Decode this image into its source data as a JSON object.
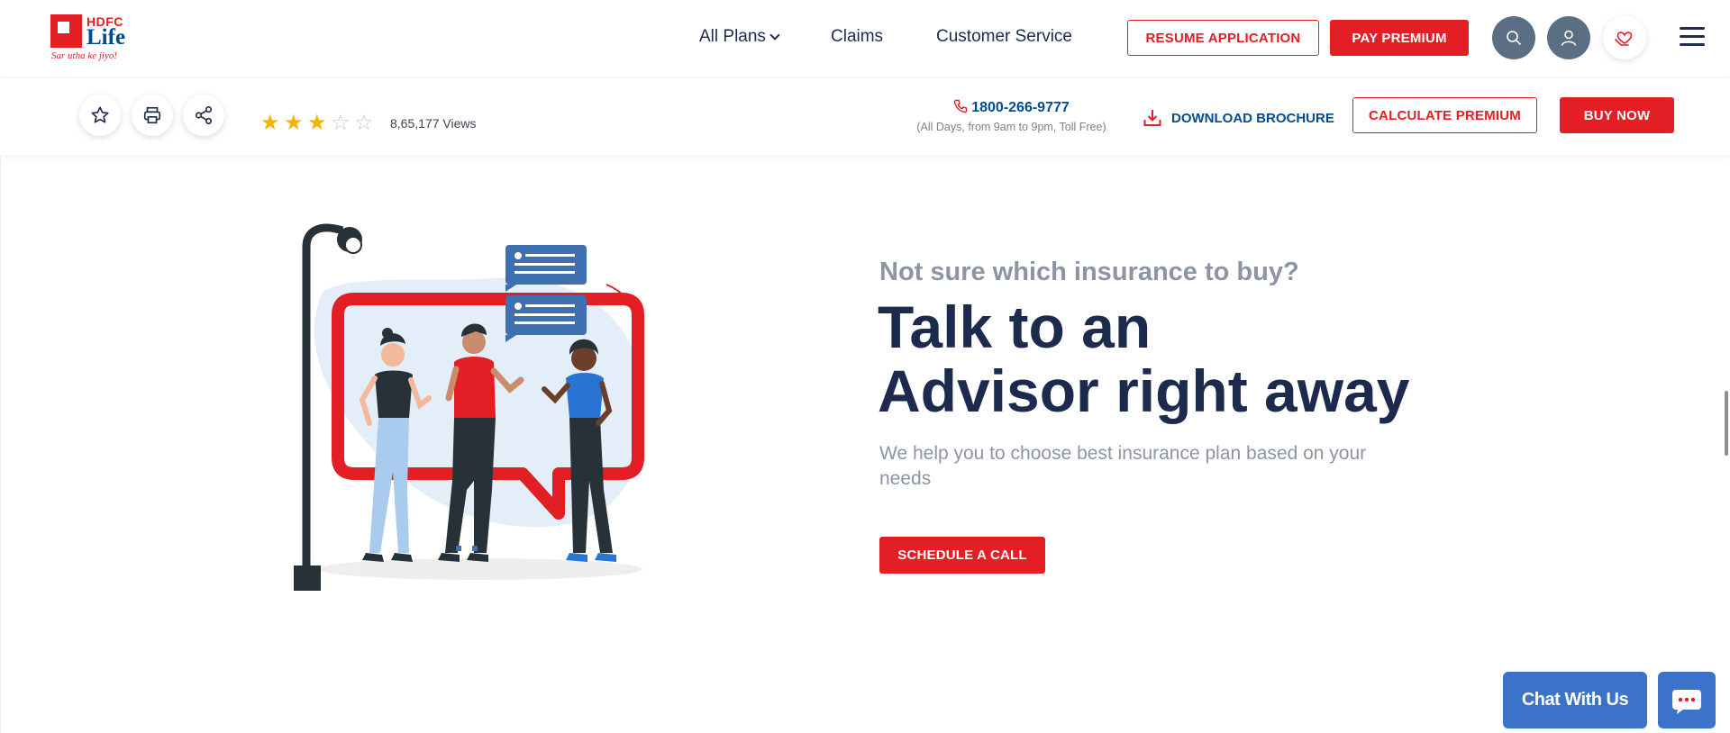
{
  "brand": {
    "name_top": "HDFC",
    "name_bottom": "Life",
    "tagline": "Sar utha ke jiyo!"
  },
  "header": {
    "nav": [
      {
        "label": "All Plans"
      },
      {
        "label": "Claims"
      },
      {
        "label": "Customer Service"
      }
    ],
    "resume_label": "RESUME APPLICATION",
    "pay_label": "PAY PREMIUM",
    "icons": [
      "search-icon",
      "user-icon",
      "heart-hand-icon",
      "menu-icon"
    ]
  },
  "subbar": {
    "tools": [
      "star-icon",
      "print-icon",
      "share-icon"
    ],
    "rating": {
      "value": 3,
      "max": 5
    },
    "views": "8,65,177 Views",
    "phone": "1800-266-9777",
    "phone_note": "(All Days, from 9am to 9pm, Toll Free)",
    "download_label": "DOWNLOAD BROCHURE",
    "calc_label": "CALCULATE PREMIUM",
    "buy_label": "BUY NOW"
  },
  "hero": {
    "subheading": "Not sure which insurance to buy?",
    "heading_line1": "Talk to an",
    "heading_line2": "Advisor right away",
    "description": "We help you to choose best insurance plan based on your needs",
    "cta_label": "SCHEDULE A CALL"
  },
  "chat": {
    "label": "Chat With Us"
  },
  "colors": {
    "brand_red": "#e31e24",
    "brand_blue": "#004c8f",
    "heading_navy": "#1c2a4d",
    "muted_gray": "#8d94a3",
    "chat_blue": "#3b73c8"
  }
}
